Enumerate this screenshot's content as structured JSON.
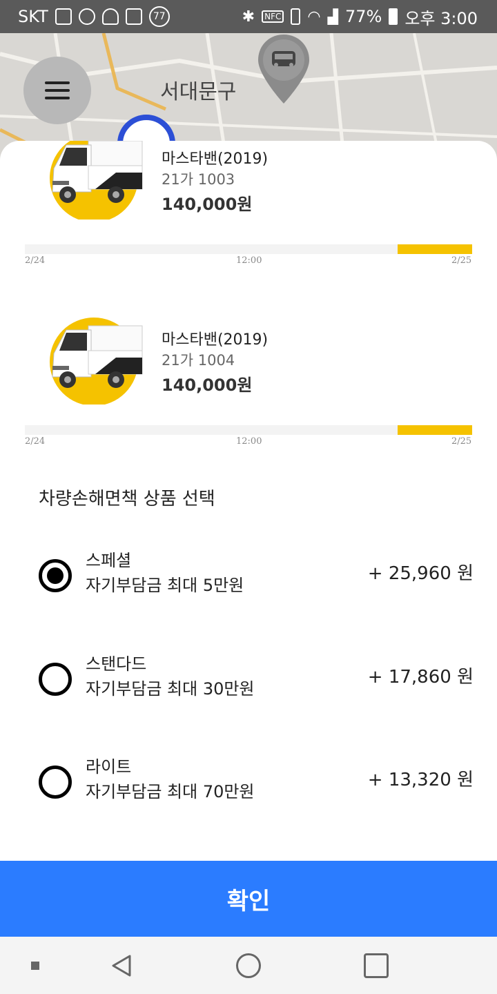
{
  "status_bar": {
    "carrier": "SKT",
    "notification_badge": "77",
    "nfc_label": "NFC",
    "battery": "77%",
    "time": "오후 3:00"
  },
  "map": {
    "district_label": "서대문구"
  },
  "vehicles": [
    {
      "name": "마스타밴(2019)",
      "plate": "21가 1003",
      "price": "140,000원",
      "timeline_ticks": [
        "2/24",
        "12:00",
        "2/25"
      ]
    },
    {
      "name": "마스타밴(2019)",
      "plate": "21가 1004",
      "price": "140,000원",
      "timeline_ticks": [
        "2/24",
        "12:00",
        "2/25"
      ]
    }
  ],
  "insurance": {
    "title": "차량손해면책 상품 선택",
    "options": [
      {
        "name": "스페셜",
        "desc": "자기부담금 최대 5만원",
        "price": "+ 25,960 원",
        "selected": true
      },
      {
        "name": "스탠다드",
        "desc": "자기부담금 최대 30만원",
        "price": "+ 17,860 원",
        "selected": false
      },
      {
        "name": "라이트",
        "desc": "자기부담금 최대 70만원",
        "price": "+ 13,320 원",
        "selected": false
      }
    ]
  },
  "confirm_label": "확인",
  "colors": {
    "accent_yellow": "#f5c200",
    "confirm_blue": "#2b7cff",
    "station_blue": "#2c4fd6"
  }
}
